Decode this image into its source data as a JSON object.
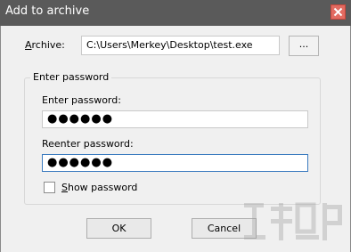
{
  "window": {
    "title": "Add to archive",
    "close_icon": "close-icon"
  },
  "archive": {
    "label_prefix": "A",
    "label_rest": "rchive:",
    "path_value": "C:\\Users\\Merkey\\Desktop\\test.exe",
    "browse_label": "..."
  },
  "password_group": {
    "legend": "Enter password",
    "enter_label": "Enter password:",
    "enter_value": "●●●●●●",
    "reenter_label": "Reenter password:",
    "reenter_value": "●●●●●●",
    "show_prefix": "S",
    "show_rest": "how password",
    "show_checked": false
  },
  "buttons": {
    "ok_label": "OK",
    "cancel_label": "Cancel"
  },
  "colors": {
    "titlebar": "#5a5a5a",
    "close_button": "#e26b61",
    "focus_border": "#3b7bbf"
  }
}
